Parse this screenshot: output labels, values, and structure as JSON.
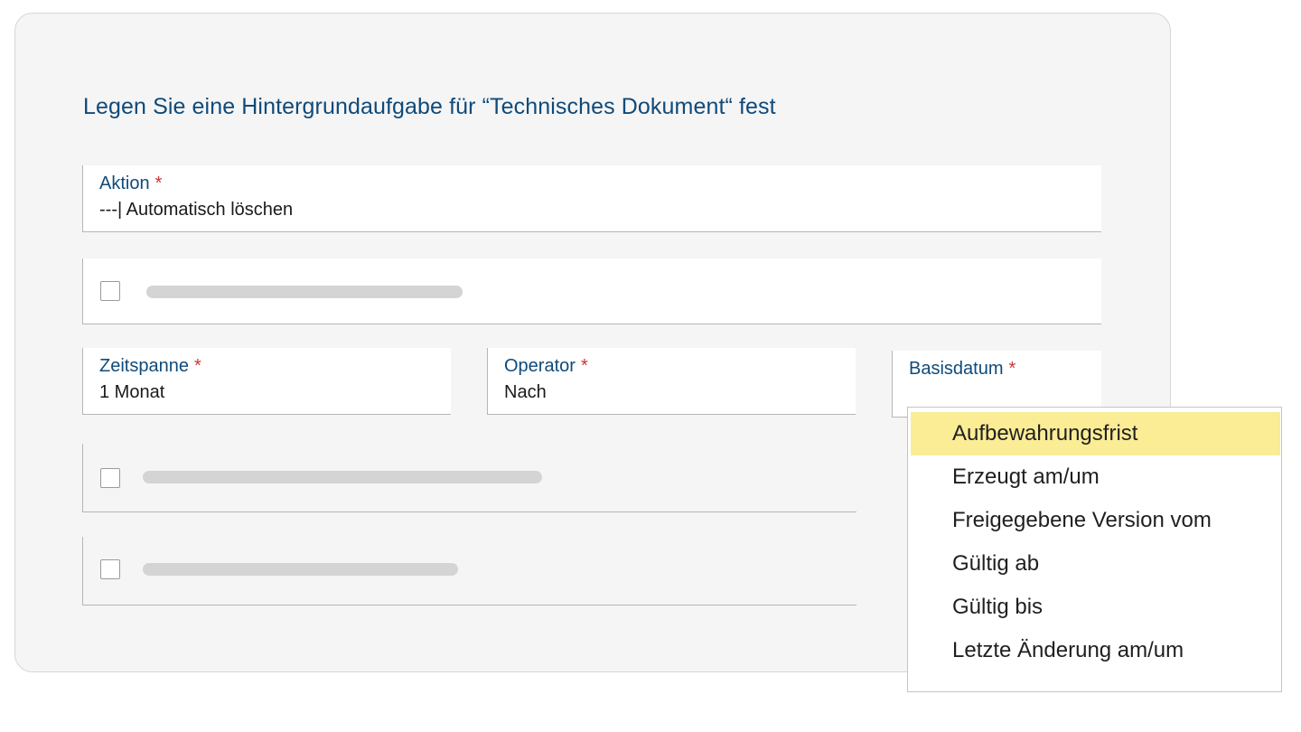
{
  "dialog": {
    "title": "Legen Sie eine Hintergrundaufgabe für “Technisches Dokument“ fest"
  },
  "fields": {
    "aktion": {
      "label": "Aktion",
      "required_mark": "*",
      "value": "---| Automatisch löschen"
    },
    "zeitspanne": {
      "label": "Zeitspanne",
      "required_mark": "*",
      "value": "1 Monat"
    },
    "operator": {
      "label": "Operator",
      "required_mark": "*",
      "value": "Nach"
    },
    "basisdatum": {
      "label": "Basisdatum",
      "required_mark": "*",
      "value": ""
    }
  },
  "basisdatum_dropdown": {
    "selected": "Aufbewahrungsfrist",
    "options": [
      "Aufbewahrungsfrist",
      "Erzeugt am/um",
      "Freigegebene Version vom",
      "Gültig ab",
      "Gültig bis",
      "Letzte Änderung am/um"
    ]
  },
  "colors": {
    "title": "#0f4a7a",
    "required": "#d23232",
    "highlight": "#fbec96",
    "panel": "#f5f5f5"
  }
}
